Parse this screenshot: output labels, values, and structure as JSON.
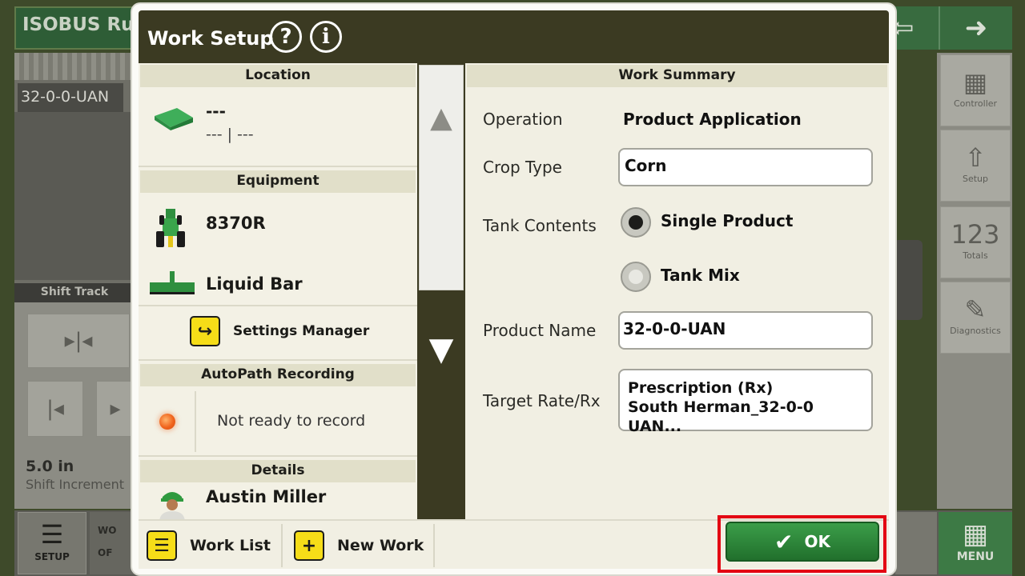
{
  "background": {
    "app_title": "ISOBUS Ru",
    "back_arrow": "⇦",
    "next_arrow": "➜",
    "product_label": "32-0-0-UAN",
    "shift_track_label": "Shift Track",
    "shift_increment_value": "5.0 in",
    "shift_increment_label": "Shift Increment",
    "setup_label": "SETUP",
    "work_label": "WO",
    "work_sub_label": "OF",
    "menu_label": "MENU",
    "side_tiles": [
      {
        "icon": "▦",
        "label": "Controller"
      },
      {
        "icon": "⇧",
        "label": "Setup"
      },
      {
        "icon": "123",
        "label": "Totals"
      },
      {
        "icon": "✎",
        "label": "Diagnostics"
      }
    ]
  },
  "modal": {
    "title": "Work Setup",
    "help_icon": "?",
    "info_icon": "i",
    "location": {
      "header": "Location",
      "line1": "---",
      "line2": "--- | ---"
    },
    "equipment": {
      "header": "Equipment",
      "tractor": "8370R",
      "implement": "Liquid Bar",
      "settings_manager": "Settings Manager"
    },
    "autopath": {
      "header": "AutoPath Recording",
      "status": "Not ready to record"
    },
    "details": {
      "header": "Details",
      "operator": "Austin Miller"
    },
    "scroll": {
      "up": "▲",
      "down": "▼"
    },
    "work_summary": {
      "header": "Work Summary",
      "operation_label": "Operation",
      "operation_value": "Product Application",
      "crop_type_label": "Crop Type",
      "crop_type_value": "Corn",
      "tank_contents_label": "Tank Contents",
      "tank_option_single": "Single Product",
      "tank_option_mix": "Tank Mix",
      "product_name_label": "Product Name",
      "product_name_value": "32-0-0-UAN",
      "target_rate_label": "Target Rate/Rx",
      "target_rate_line1": "Prescription (Rx)",
      "target_rate_line2": "South Herman_32-0-0 UAN..."
    },
    "footer": {
      "work_list": "Work List",
      "new_work": "New Work",
      "ok": "OK",
      "list_glyph": "☰",
      "plus_glyph": "+",
      "arrow_glyph": "↪",
      "check_glyph": "✔"
    }
  },
  "colors": {
    "header": "#3b3a22",
    "section_header": "#e1dfc9",
    "ok_green": "#2e8a3c",
    "highlight_red": "#e30613",
    "action_yellow": "#f6dd18"
  }
}
